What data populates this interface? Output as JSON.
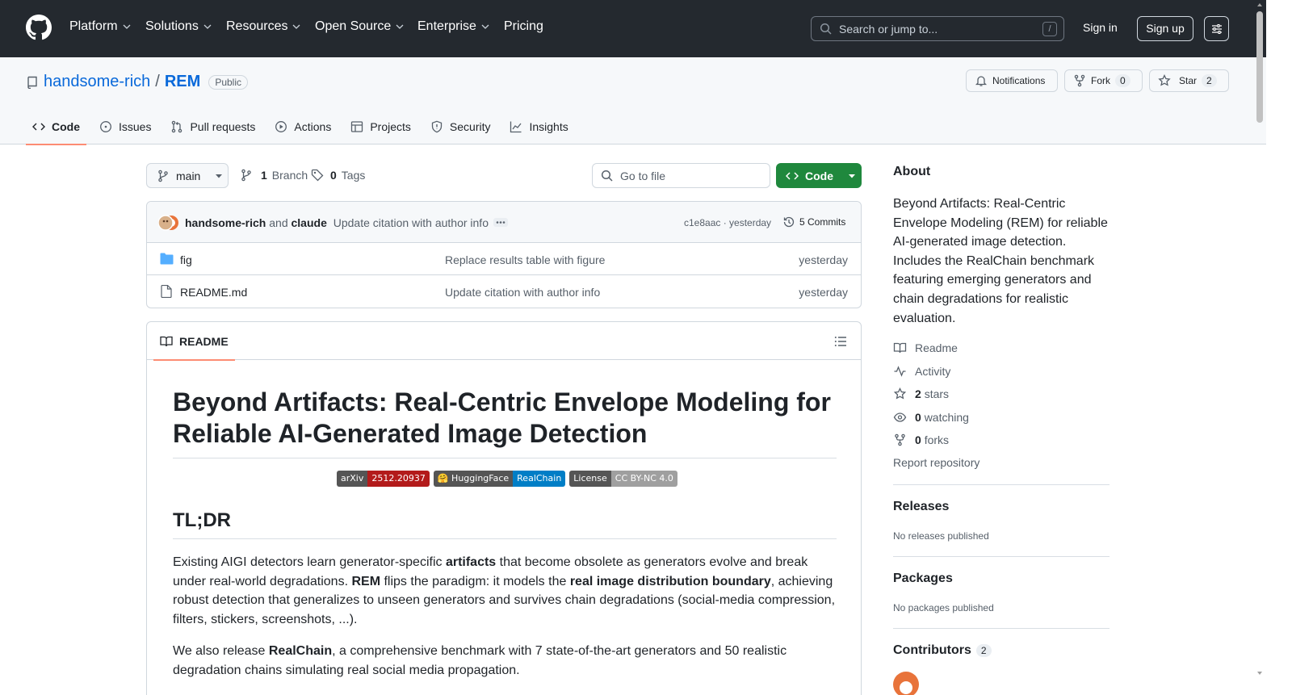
{
  "header": {
    "nav": [
      "Platform",
      "Solutions",
      "Resources",
      "Open Source",
      "Enterprise",
      "Pricing"
    ],
    "search_placeholder": "Search or jump to...",
    "search_key": "/",
    "signin": "Sign in",
    "signup": "Sign up"
  },
  "repo": {
    "owner": "handsome-rich",
    "separator": "/",
    "name": "REM",
    "visibility": "Public",
    "notifications_label": "Notifications",
    "fork_label": "Fork",
    "fork_count": "0",
    "star_label": "Star",
    "star_count": "2"
  },
  "tabs": [
    "Code",
    "Issues",
    "Pull requests",
    "Actions",
    "Projects",
    "Security",
    "Insights"
  ],
  "toolbar": {
    "branch": "main",
    "branches_count": "1",
    "branches_label": "Branch",
    "tags_count": "0",
    "tags_label": "Tags",
    "goto_placeholder": "Go to file",
    "code_button": "Code"
  },
  "commit": {
    "author1": "handsome-rich",
    "and": "and",
    "author2": "claude",
    "message": "Update citation with author info",
    "hash": "c1e8aac · yesterday",
    "commits_label": "5 Commits"
  },
  "files": [
    {
      "name": "fig",
      "type": "folder",
      "message": "Replace results table with figure",
      "time": "yesterday"
    },
    {
      "name": "README.md",
      "type": "file",
      "message": "Update citation with author info",
      "time": "yesterday"
    }
  ],
  "readme": {
    "tab_label": "README",
    "title": "Beyond Artifacts: Real-Centric Envelope Modeling for Reliable AI-Generated Image Detection",
    "badges": [
      {
        "label": "arXiv",
        "value": "2512.20937",
        "color": "#b31b1b"
      },
      {
        "label": "🤗 HuggingFace",
        "value": "RealChain",
        "color": "#007ec6"
      },
      {
        "label": "License",
        "value": "CC BY-NC 4.0",
        "color": "#9f9f9f"
      }
    ],
    "tldr_heading": "TL;DR",
    "p1": {
      "t1": "Existing AIGI detectors learn generator-specific ",
      "b1": "artifacts",
      "t2": " that become obsolete as generators evolve and break under real-world degradations. ",
      "b2": "REM",
      "t3": " flips the paradigm: it models the ",
      "b3": "real image distribution boundary",
      "t4": ", achieving robust detection that generalizes to unseen generators and survives chain degradations (social-media compression, filters, stickers, screenshots, ...)."
    },
    "p2": {
      "t1": "We also release ",
      "b1": "RealChain",
      "t2": ", a comprehensive benchmark with 7 state-of-the-art generators and 50 realistic degradation chains simulating real social media propagation."
    }
  },
  "sidebar": {
    "about_heading": "About",
    "description": "Beyond Artifacts: Real-Centric Envelope Modeling (REM) for reliable AI-generated image detection. Includes the RealChain benchmark featuring emerging generators and chain degradations for realistic evaluation.",
    "readme_link": "Readme",
    "activity_link": "Activity",
    "stars_count": "2",
    "stars_label": "stars",
    "watching_count": "0",
    "watching_label": "watching",
    "forks_count": "0",
    "forks_label": "forks",
    "report": "Report repository",
    "releases_heading": "Releases",
    "releases_text": "No releases published",
    "packages_heading": "Packages",
    "packages_text": "No packages published",
    "contributors_heading": "Contributors",
    "contributors_count": "2"
  },
  "colors": {
    "header_bg": "#24292f",
    "link": "#0969da",
    "primary_button": "#1f883d",
    "active_tab_underline": "#fd8c73"
  }
}
